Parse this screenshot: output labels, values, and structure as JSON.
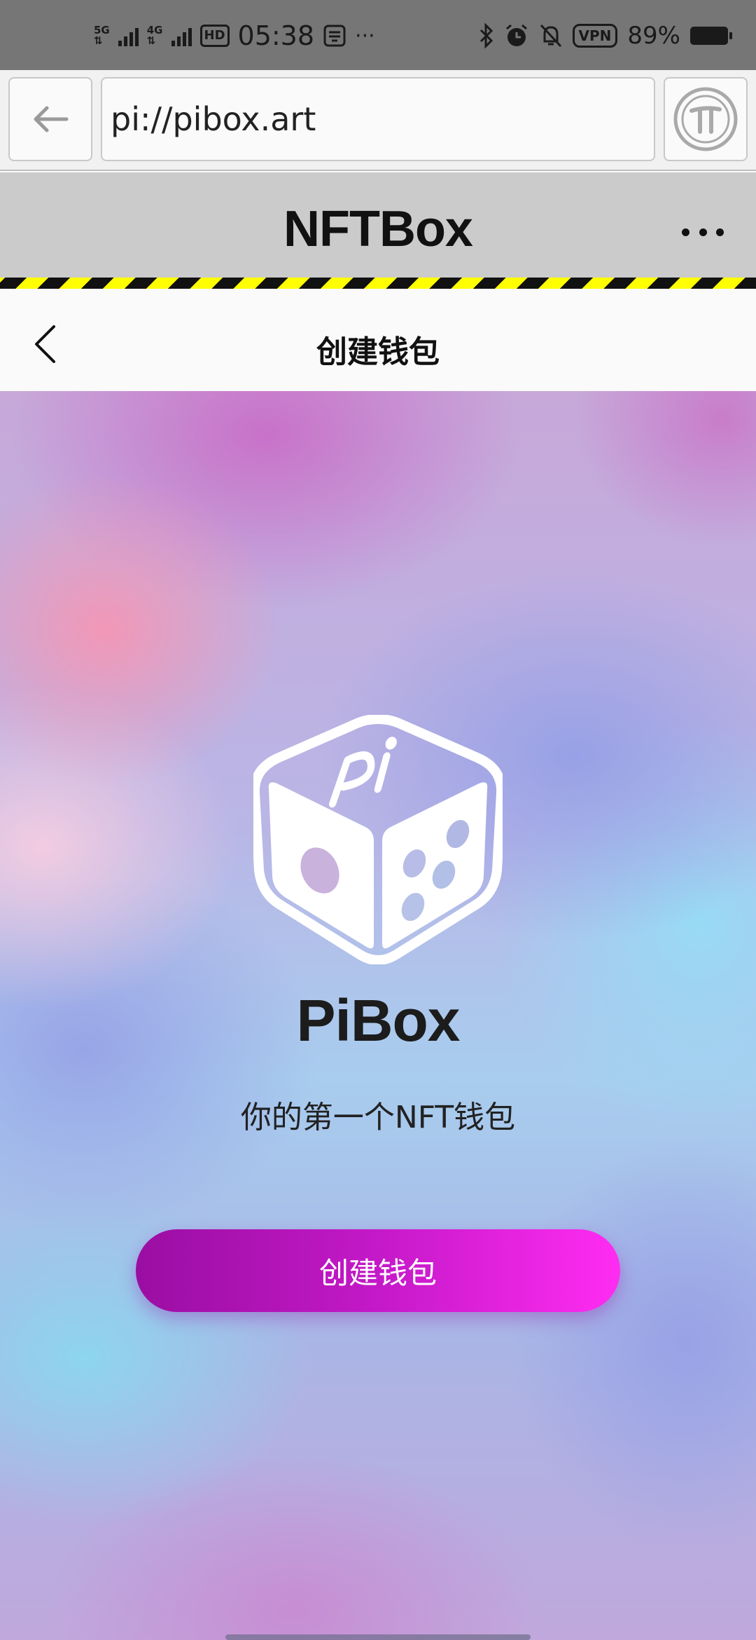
{
  "status_bar": {
    "network1": "5G",
    "network2": "4G",
    "hd_label": "HD",
    "time": "05:38",
    "more": "···",
    "vpn_label": "VPN",
    "battery_percent": "89%",
    "battery_level": 0.89
  },
  "browser": {
    "url": "pi://pibox.art",
    "back_icon": "arrow-left-icon",
    "pi_icon": "pi-browser-logo-icon"
  },
  "app_header": {
    "title": "NFTBox",
    "more_icon": "more-horizontal-icon"
  },
  "page_header": {
    "title": "创建钱包",
    "back_icon": "chevron-left-icon"
  },
  "main": {
    "logo_icon": "pibox-dice-logo-icon",
    "logo_text": "Pi",
    "brand_name": "PiBox",
    "tagline": "你的第一个NFT钱包",
    "create_button_label": "创建钱包"
  },
  "colors": {
    "hazard_yellow": "#ffff00",
    "button_start": "#9a0ea2",
    "button_end": "#ff2cf2",
    "app_header_bg": "#cbcbcb"
  }
}
